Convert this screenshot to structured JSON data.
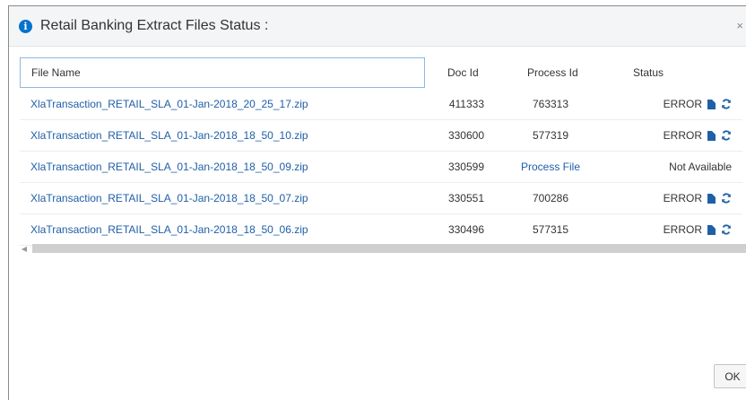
{
  "dialog": {
    "title": "Retail Banking Extract Files Status :",
    "close_label": "×",
    "ok_label": "OK"
  },
  "table": {
    "columns": [
      "File Name",
      "Doc Id",
      "Process Id",
      "Status"
    ],
    "rows": [
      {
        "file": "XlaTransaction_RETAIL_SLA_01-Jan-2018_20_25_17.zip",
        "doc_id": "411333",
        "process_id": "763313",
        "status": "ERROR",
        "icons": true
      },
      {
        "file": "XlaTransaction_RETAIL_SLA_01-Jan-2018_18_50_10.zip",
        "doc_id": "330600",
        "process_id": "577319",
        "status": "ERROR",
        "icons": true
      },
      {
        "file": "XlaTransaction_RETAIL_SLA_01-Jan-2018_18_50_09.zip",
        "doc_id": "330599",
        "process_id": "Process File",
        "status": "Not Available",
        "icons": false
      },
      {
        "file": "XlaTransaction_RETAIL_SLA_01-Jan-2018_18_50_07.zip",
        "doc_id": "330551",
        "process_id": "700286",
        "status": "ERROR",
        "icons": true
      },
      {
        "file": "XlaTransaction_RETAIL_SLA_01-Jan-2018_18_50_06.zip",
        "doc_id": "330496",
        "process_id": "577315",
        "status": "ERROR",
        "icons": true
      }
    ]
  },
  "colors": {
    "accent": "#0572ce",
    "link": "#1f5fa8"
  }
}
